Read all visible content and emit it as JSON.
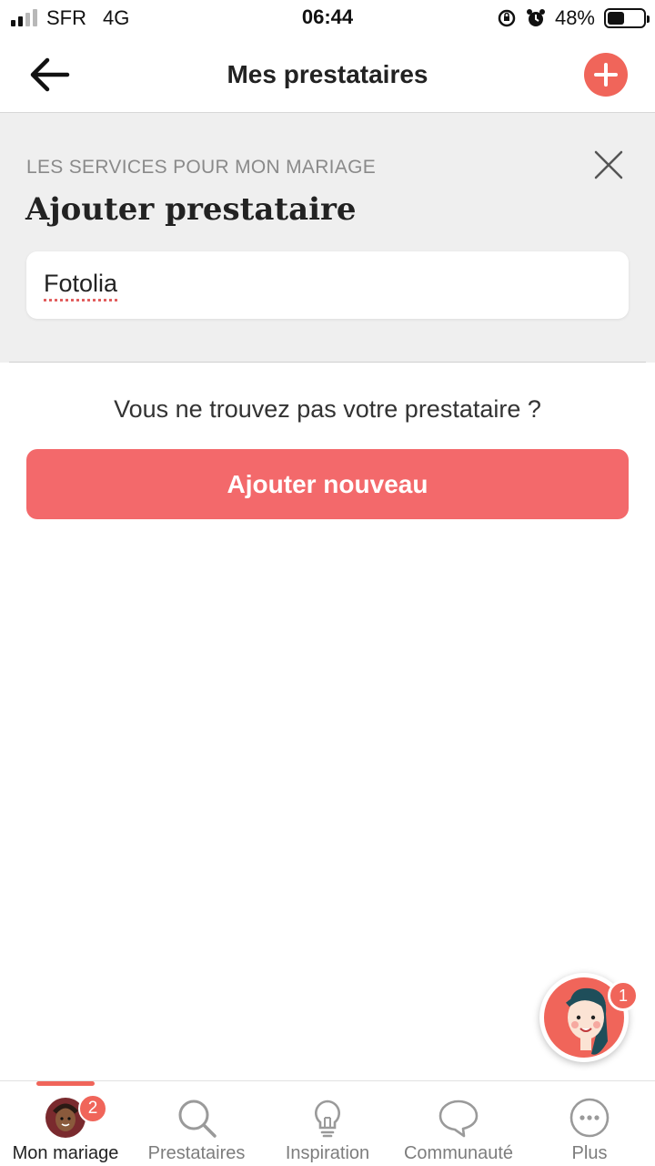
{
  "status_bar": {
    "carrier": "SFR",
    "network": "4G",
    "time": "06:44",
    "battery": "48%",
    "battery_level": 0.48,
    "signal_bars": 2
  },
  "header": {
    "title": "Mes prestataires",
    "back_icon": "arrow-left-icon",
    "add_icon": "plus-icon"
  },
  "panel": {
    "kicker": "LES SERVICES POUR MON MARIAGE",
    "title": "Ajouter prestataire",
    "close_icon": "close-icon",
    "search_value": "Fotolia"
  },
  "not_found": {
    "text": "Vous ne trouvez pas votre prestataire ?",
    "button_label": "Ajouter nouveau"
  },
  "assistant": {
    "badge": "1"
  },
  "tab_bar": {
    "tabs": [
      {
        "label": "Mon mariage",
        "icon": "avatar-icon",
        "badge": "2",
        "active": true
      },
      {
        "label": "Prestataires",
        "icon": "search-icon",
        "active": false
      },
      {
        "label": "Inspiration",
        "icon": "lightbulb-icon",
        "active": false
      },
      {
        "label": "Communauté",
        "icon": "chat-bubble-icon",
        "active": false
      },
      {
        "label": "Plus",
        "icon": "more-icon",
        "active": false
      }
    ]
  },
  "colors": {
    "accent": "#f0655a",
    "button": "#f3696b",
    "panel_bg": "#efefef"
  }
}
